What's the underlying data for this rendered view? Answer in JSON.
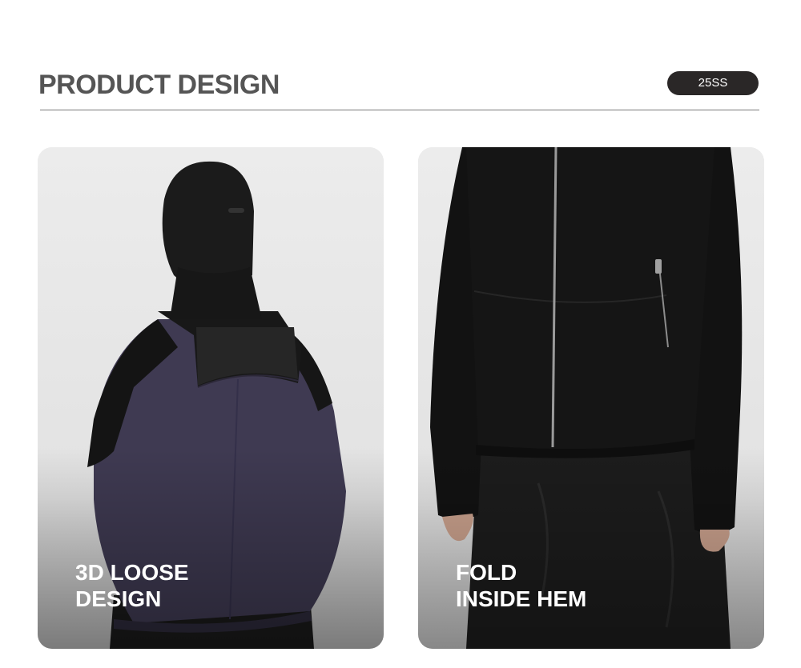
{
  "header": {
    "title": "PRODUCT DESIGN",
    "season_badge": "25SS"
  },
  "cards": [
    {
      "caption_line1": "3D LOOSE",
      "caption_line2": "DESIGN",
      "jacket_color": "#3f3a52",
      "panel_color": "#141414"
    },
    {
      "caption_line1": "FOLD",
      "caption_line2": "INSIDE HEM",
      "jacket_color": "#141414",
      "zipper_color": "#9a9a9a"
    }
  ]
}
